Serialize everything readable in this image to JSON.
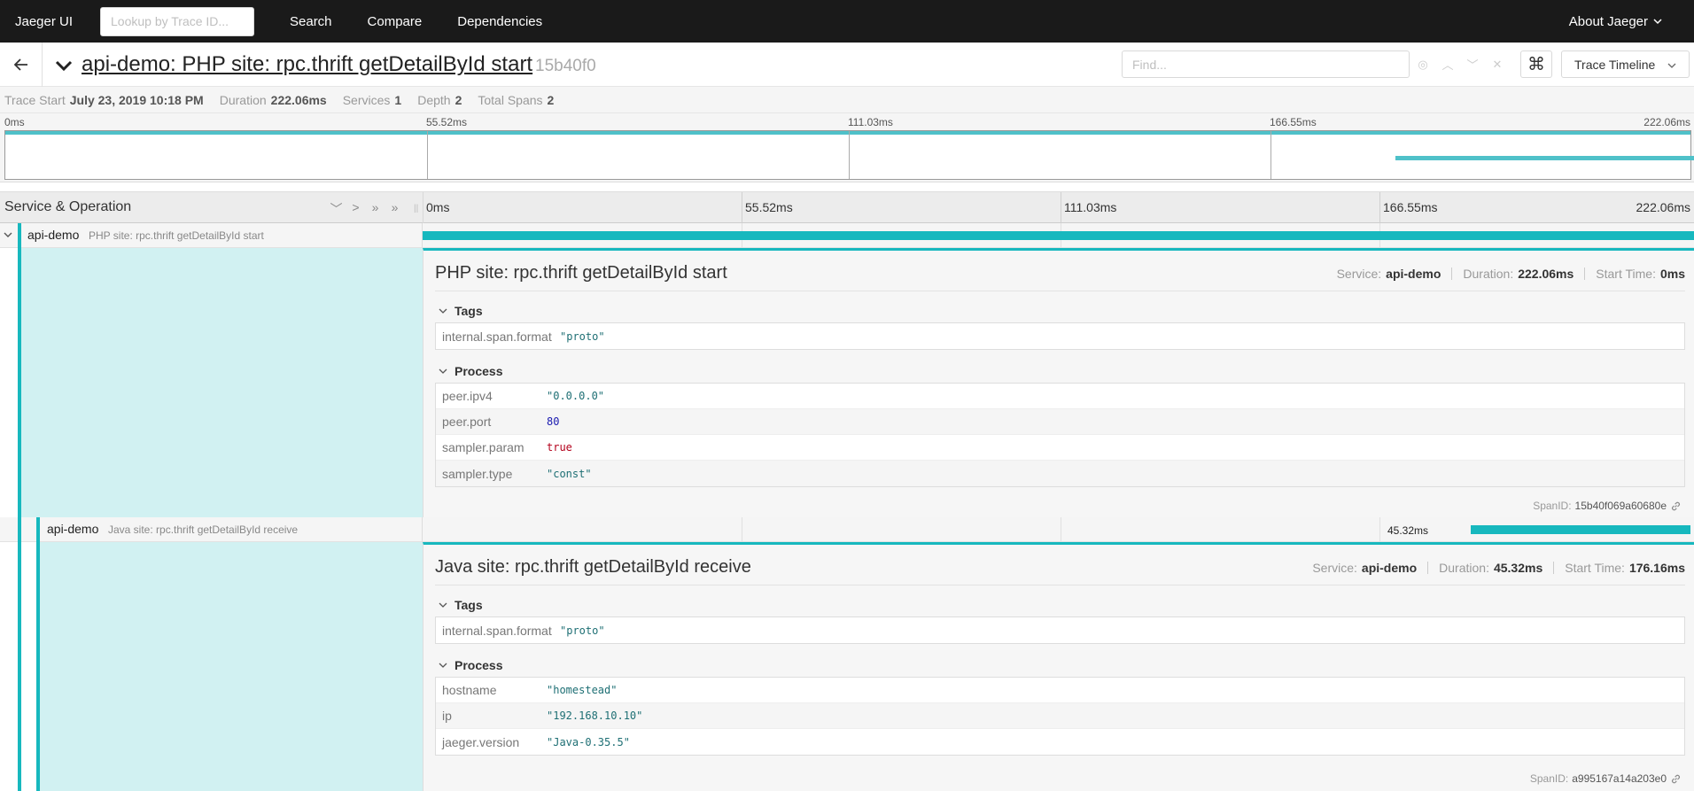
{
  "nav": {
    "brand": "Jaeger UI",
    "lookup_placeholder": "Lookup by Trace ID...",
    "links": [
      "Search",
      "Compare",
      "Dependencies"
    ],
    "about": "About Jaeger"
  },
  "trace": {
    "title": "api-demo: PHP site: rpc.thrift getDetailById start",
    "id": "15b40f0",
    "find_placeholder": "Find...",
    "view": "Trace Timeline",
    "shortcut_icon": "⌘"
  },
  "summary": {
    "trace_start_label": "Trace Start",
    "trace_start": "July 23, 2019 10:18 PM",
    "duration_label": "Duration",
    "duration": "222.06ms",
    "services_label": "Services",
    "services": "1",
    "depth_label": "Depth",
    "depth": "2",
    "spans_label": "Total Spans",
    "spans": "2"
  },
  "ticks": [
    "0ms",
    "55.52ms",
    "111.03ms",
    "166.55ms",
    "222.06ms"
  ],
  "timeline": {
    "header": "Service & Operation"
  },
  "spans": [
    {
      "service": "api-demo",
      "operation": "PHP site: rpc.thrift getDetailById start",
      "start_ms": 0,
      "duration_ms": 222.06,
      "detail": {
        "title": "PHP site: rpc.thrift getDetailById start",
        "service_label": "Service:",
        "service": "api-demo",
        "duration_label": "Duration:",
        "duration": "222.06ms",
        "start_label": "Start Time:",
        "start": "0ms",
        "tags_label": "Tags",
        "tags": [
          {
            "key": "internal.span.format",
            "value": "\"proto\""
          }
        ],
        "process_label": "Process",
        "process": [
          {
            "key": "peer.ipv4",
            "value": "\"0.0.0.0\""
          },
          {
            "key": "peer.port",
            "value": "80"
          },
          {
            "key": "sampler.param",
            "value": "true"
          },
          {
            "key": "sampler.type",
            "value": "\"const\""
          }
        ],
        "spanid_label": "SpanID:",
        "spanid": "15b40f069a60680e"
      }
    },
    {
      "service": "api-demo",
      "operation": "Java site: rpc.thrift getDetailById receive",
      "start_ms": 176.16,
      "duration_ms": 45.32,
      "duration_text": "45.32ms",
      "detail": {
        "title": "Java site: rpc.thrift getDetailById receive",
        "service_label": "Service:",
        "service": "api-demo",
        "duration_label": "Duration:",
        "duration": "45.32ms",
        "start_label": "Start Time:",
        "start": "176.16ms",
        "tags_label": "Tags",
        "tags": [
          {
            "key": "internal.span.format",
            "value": "\"proto\""
          }
        ],
        "process_label": "Process",
        "process": [
          {
            "key": "hostname",
            "value": "\"homestead\""
          },
          {
            "key": "ip",
            "value": "\"192.168.10.10\""
          },
          {
            "key": "jaeger.version",
            "value": "\"Java-0.35.5\""
          }
        ],
        "spanid_label": "SpanID:",
        "spanid": "a995167a14a203e0"
      }
    }
  ],
  "colors": {
    "accent": "#17b8be",
    "nav_bg": "#1a1a1a",
    "detail_left": "#d1f1f2"
  }
}
